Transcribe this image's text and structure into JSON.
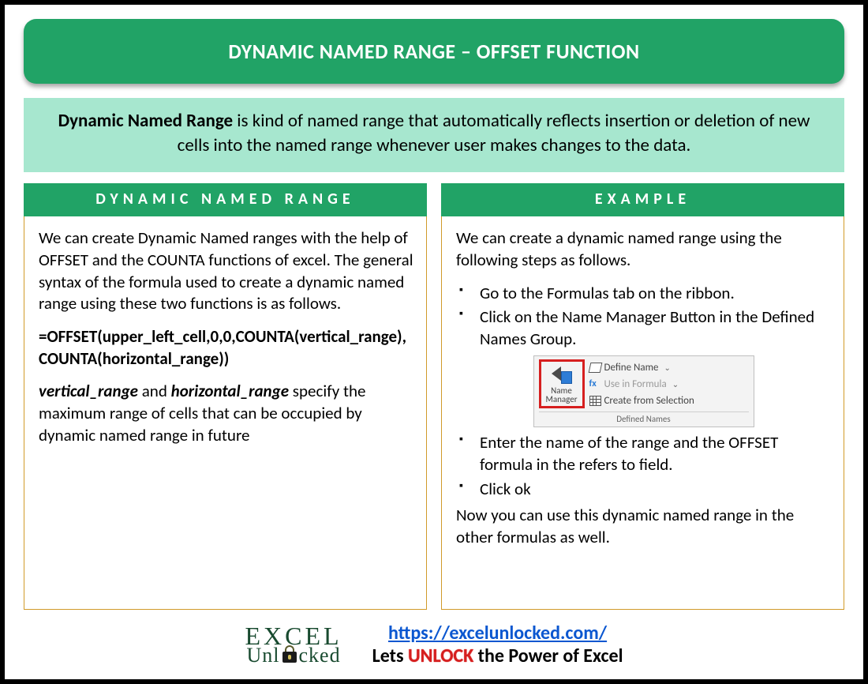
{
  "title": "DYNAMIC NAMED RANGE – OFFSET FUNCTION",
  "intro": {
    "term": "Dynamic Named Range",
    "rest": " is kind of named range that automatically reflects insertion or deletion of new cells into the named range whenever user makes changes to the data."
  },
  "left": {
    "header": "DYNAMIC NAMED RANGE",
    "para1": "We can create Dynamic Named ranges with the help of OFFSET and the COUNTA functions of excel. The general syntax of the formula used to create a dynamic named range using these two functions is as follows.",
    "formula": "=OFFSET(upper_left_cell,0,0,COUNTA(vertical_range),COUNTA(horizontal_range))",
    "param1": "vertical_range",
    "param_and": " and ",
    "param2": "horizontal_range",
    "param_rest": " specify the maximum range of cells that can be occupied by dynamic named range in future"
  },
  "right": {
    "header": "EXAMPLE",
    "intro": "We can create a dynamic named range using the following steps as follows.",
    "steps": [
      "Go to the Formulas tab on the ribbon.",
      "Click on the Name Manager Button in the Defined Names Group."
    ],
    "steps_after": [
      "Enter the name of the range and the OFFSET formula in the refers to field.",
      "Click ok"
    ],
    "closing": "Now you can use this dynamic named range in the other formulas as well.",
    "ribbon": {
      "name_manager": "Name Manager",
      "opt1": "Define Name",
      "opt2": "Use in Formula",
      "opt3": "Create from Selection",
      "group": "Defined Names"
    }
  },
  "footer": {
    "logo_row1": "EXCEL",
    "logo_row2_a": "Unl",
    "logo_row2_b": "cked",
    "url": "https://excelunlocked.com/",
    "tag_a": "Lets ",
    "tag_unlock": "UNLOCK",
    "tag_b": " the Power of Excel"
  }
}
